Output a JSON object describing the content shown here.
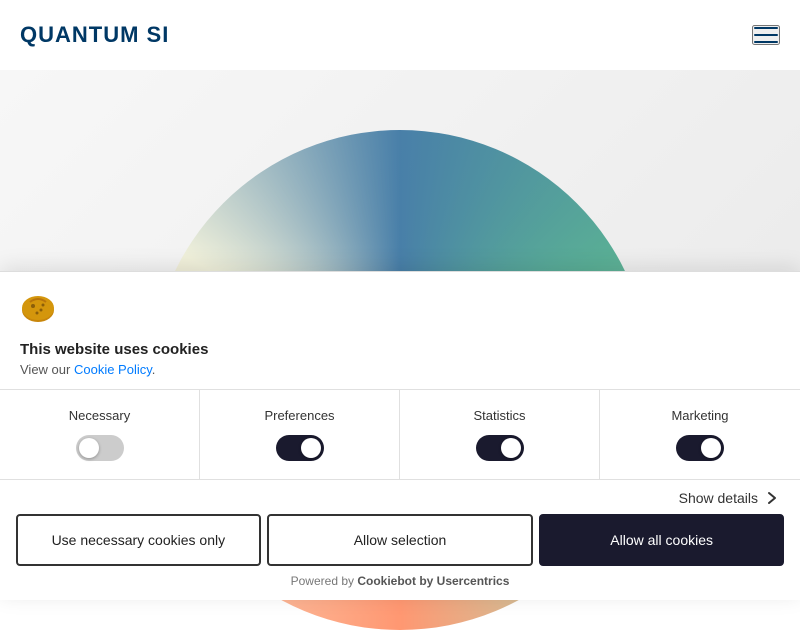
{
  "header": {
    "logo_text": "QUANTUM SI",
    "menu_aria": "Open menu"
  },
  "cookie_banner": {
    "icon_label": "cookie",
    "title": "This website uses cookies",
    "description_prefix": "View our ",
    "cookie_policy_label": "Cookie Policy",
    "description_suffix": ".",
    "toggles": [
      {
        "id": "necessary",
        "label": "Necessary",
        "state": "off"
      },
      {
        "id": "preferences",
        "label": "Preferences",
        "state": "on"
      },
      {
        "id": "statistics",
        "label": "Statistics",
        "state": "on"
      },
      {
        "id": "marketing",
        "label": "Marketing",
        "state": "on"
      }
    ],
    "show_details_label": "Show details",
    "buttons": {
      "necessary_only": "Use necessary cookies only",
      "allow_selection": "Allow selection",
      "allow_all": "Allow all cookies"
    },
    "powered_by_prefix": "Powered by ",
    "powered_by_link": "Cookiebot by Usercentrics"
  }
}
